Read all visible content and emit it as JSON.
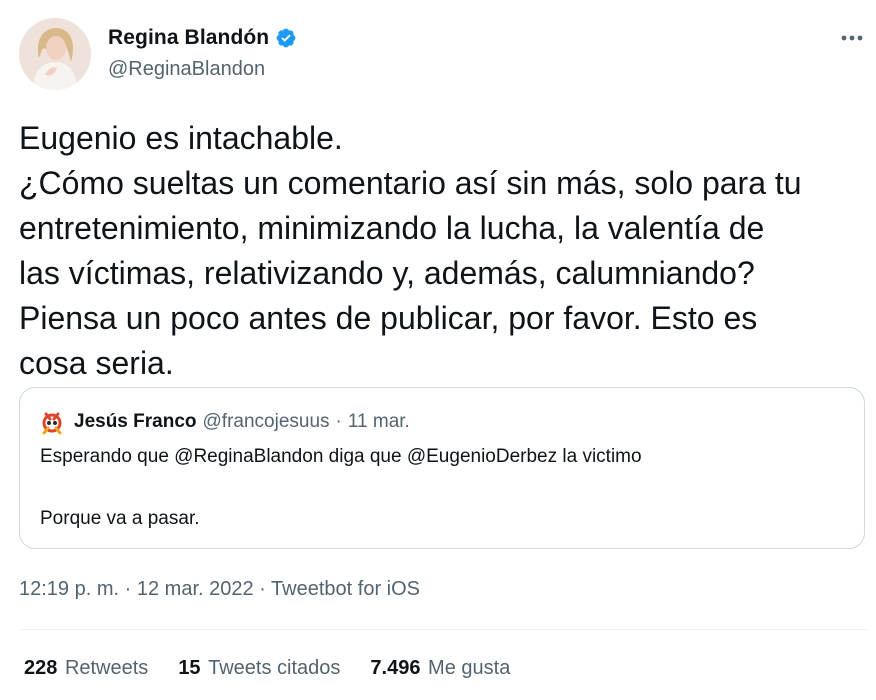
{
  "author": {
    "name": "Regina Blandón",
    "handle": "@ReginaBlandon",
    "verified": true,
    "avatar_icon": "profile-photo"
  },
  "more_icon": "more-horizontal-icon",
  "tweet": {
    "lines": [
      "Eugenio es intachable.",
      "¿Cómo sueltas un comentario así sin más, solo para tu",
      "entretenimiento, minimizando la lucha, la valentía de",
      "las víctimas, relativizando y, además, calumniando?",
      "Piensa un poco antes de publicar, por favor. Esto es",
      "cosa seria."
    ]
  },
  "quoted_tweet": {
    "name": "Jesús Franco",
    "handle": "@francojesuus",
    "separator": "·",
    "date": "11 mar.",
    "line1": "Esperando que @ReginaBlandon diga que @EugenioDerbez la victimo",
    "line2": "Porque va a pasar."
  },
  "meta": {
    "time": "12:19 p. m.",
    "separator": "·",
    "date": "12 mar. 2022",
    "source": "Tweetbot for iOS"
  },
  "stats": {
    "retweets": {
      "count": "228",
      "label": "Retweets"
    },
    "quotes": {
      "count": "15",
      "label": "Tweets citados"
    },
    "likes": {
      "count": "7.496",
      "label": "Me gusta"
    }
  },
  "colors": {
    "text": "#0f1419",
    "secondary": "#536471",
    "verified": "#1d9bf0",
    "border": "#cfd9de"
  }
}
